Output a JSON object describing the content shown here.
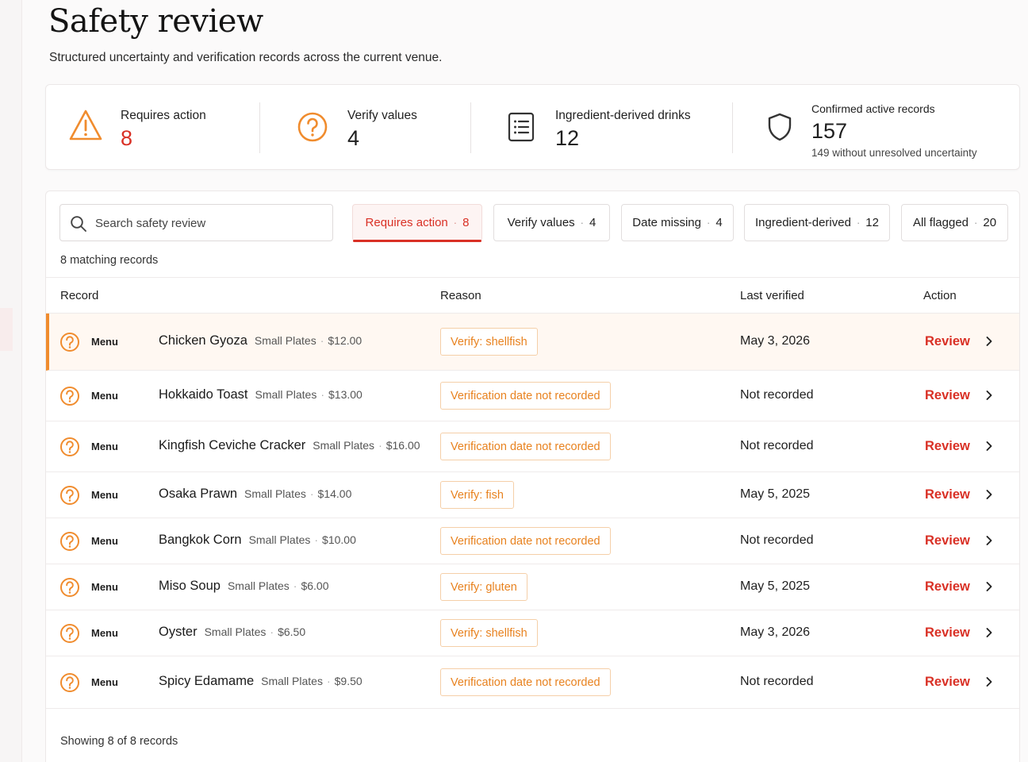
{
  "page": {
    "title": "Safety review",
    "subtitle": "Structured uncertainty and verification records across the current venue."
  },
  "colors": {
    "accent_red": "#d93025",
    "accent_orange": "#f08c2e",
    "reason_text": "#e8821f"
  },
  "stats": [
    {
      "icon": "warning-triangle-icon",
      "label": "Requires action",
      "value": "8"
    },
    {
      "icon": "question-circle-icon",
      "label": "Verify values",
      "value": "4"
    },
    {
      "icon": "list-document-icon",
      "label": "Ingredient-derived drinks",
      "value": "12"
    },
    {
      "icon": "shield-icon",
      "label": "Confirmed active records",
      "value": "157",
      "sub": "149 without unresolved uncertainty"
    }
  ],
  "search": {
    "placeholder": "Search safety review"
  },
  "filters": [
    {
      "label": "Requires action",
      "count": "8",
      "active": true
    },
    {
      "label": "Verify values",
      "count": "4"
    },
    {
      "label": "Date missing",
      "count": "4"
    },
    {
      "label": "Ingredient-derived",
      "count": "12"
    },
    {
      "label": "All flagged",
      "count": "20"
    }
  ],
  "matching": "8 matching records",
  "table": {
    "headers": {
      "record": "Record",
      "reason": "Reason",
      "last_verified": "Last verified",
      "action": "Action"
    },
    "rows": [
      {
        "source": "Menu",
        "name": "Chicken Gyoza",
        "category": "Small Plates",
        "price": "$12.00",
        "reason": "Verify: shellfish",
        "date": "May 3, 2026",
        "action": "Review"
      },
      {
        "source": "Menu",
        "name": "Hokkaido Toast",
        "category": "Small Plates",
        "price": "$13.00",
        "reason": "Verification date not recorded",
        "date": "Not recorded",
        "action": "Review"
      },
      {
        "source": "Menu",
        "name": "Kingfish Ceviche Cracker",
        "category": "Small Plates",
        "price": "$16.00",
        "reason": "Verification date not recorded",
        "date": "Not recorded",
        "action": "Review"
      },
      {
        "source": "Menu",
        "name": "Osaka Prawn",
        "category": "Small Plates",
        "price": "$14.00",
        "reason": "Verify:  fish",
        "date": "May 5, 2025",
        "action": "Review"
      },
      {
        "source": "Menu",
        "name": "Bangkok Corn",
        "category": "Small Plates",
        "price": "$10.00",
        "reason": "Verification date not recorded",
        "date": "Not recorded",
        "action": "Review"
      },
      {
        "source": "Menu",
        "name": "Miso Soup",
        "category": "Small Plates",
        "price": "$6.00",
        "reason": "Verify: gluten",
        "date": "May 5, 2025",
        "action": "Review"
      },
      {
        "source": "Menu",
        "name": "Oyster",
        "category": "Small Plates",
        "price": "$6.50",
        "reason": "Verify: shellfish",
        "date": "May 3, 2026",
        "action": "Review"
      },
      {
        "source": "Menu",
        "name": "Spicy Edamame",
        "category": "Small Plates",
        "price": "$9.50",
        "reason": "Verification date not recorded",
        "date": "Not recorded",
        "action": "Review"
      }
    ]
  },
  "footer": "Showing 8 of 8 records"
}
